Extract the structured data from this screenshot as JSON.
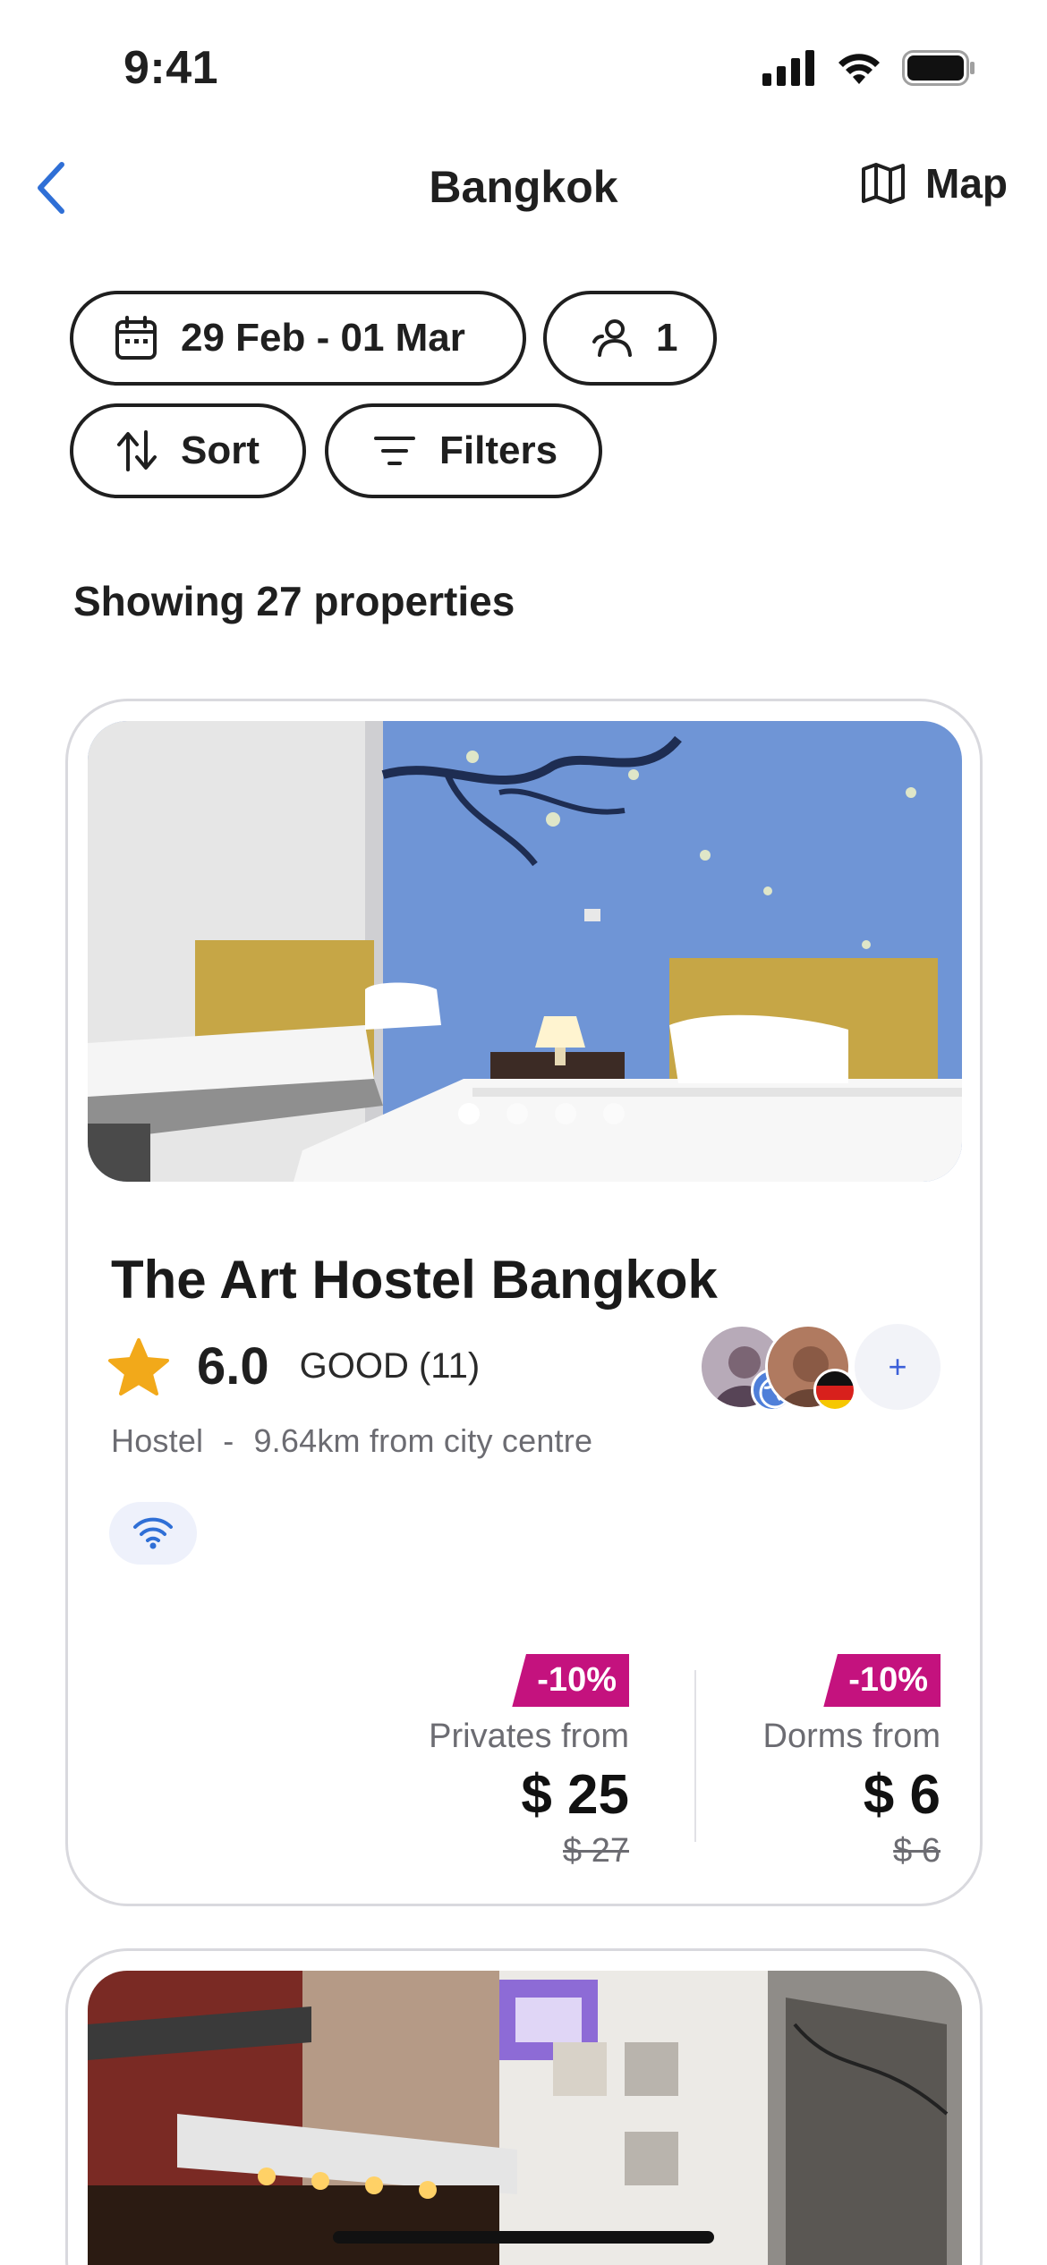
{
  "status_bar": {
    "time": "9:41"
  },
  "nav": {
    "title": "Bangkok",
    "map_label": "Map"
  },
  "search": {
    "dates": "29 Feb - 01 Mar",
    "guests": "1",
    "sort_label": "Sort",
    "filters_label": "Filters"
  },
  "results": {
    "count_text": "Showing 27 properties"
  },
  "listing": {
    "name": "The Art Hostel Bangkok",
    "rating": "6.0",
    "rating_label": "GOOD (11)",
    "type": "Hostel",
    "separator": "-",
    "distance": "9.64km from city centre",
    "photo_count": 4,
    "active_photo": 1,
    "amenities": [
      "wifi-icon"
    ],
    "privates": {
      "discount": "-10%",
      "label": "Privates from",
      "price": "$ 25",
      "old_price": "$ 27"
    },
    "dorms": {
      "discount": "-10%",
      "label": "Dorms from",
      "price": "$ 6",
      "old_price": "$ 6"
    },
    "plus_label": "+"
  },
  "colors": {
    "accent": "#2f6fd6",
    "discount": "#c4127e",
    "star": "#f2a91a",
    "muted": "#6c6c72"
  }
}
